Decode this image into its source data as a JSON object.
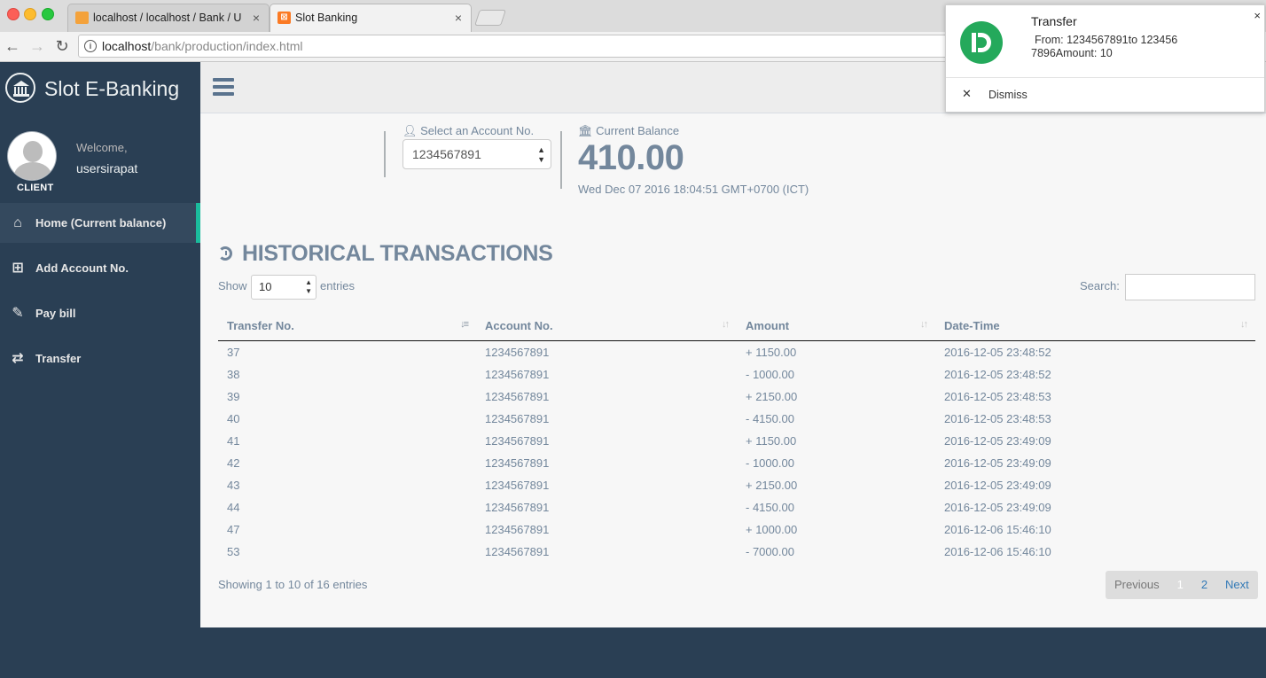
{
  "browser": {
    "tabs": [
      {
        "title": "localhost / localhost / Bank / U",
        "close": "×"
      },
      {
        "title": "Slot Banking",
        "close": "×"
      }
    ],
    "url_host": "localhost",
    "url_path": "/bank/production/index.html"
  },
  "sidebar": {
    "brand": "Slot E-Banking",
    "welcome": "Welcome,",
    "username": "usersirapat",
    "role": "CLIENT",
    "menu": [
      {
        "label": "Home (Current balance)",
        "icon": "home-icon"
      },
      {
        "label": "Add Account No.",
        "icon": "plus-square-icon"
      },
      {
        "label": "Pay bill",
        "icon": "edit-icon"
      },
      {
        "label": "Transfer",
        "icon": "exchange-icon"
      }
    ]
  },
  "account": {
    "select_label": "Select an Account No.",
    "selected": "1234567891"
  },
  "balance": {
    "label": "Current Balance",
    "value": "410.00",
    "datetime": "Wed Dec 07 2016 18:04:51 GMT+0700 (ICT)"
  },
  "history": {
    "title": "HISTORICAL TRANSACTIONS",
    "show_label": "Show",
    "page_size": "10",
    "entries_label": "entries",
    "search_label": "Search:",
    "search_value": "",
    "columns": [
      "Transfer No.",
      "Account No.",
      "Amount",
      "Date-Time"
    ],
    "rows": [
      [
        "37",
        "1234567891",
        "+ 1150.00",
        "2016-12-05 23:48:52"
      ],
      [
        "38",
        "1234567891",
        "- 1000.00",
        "2016-12-05 23:48:52"
      ],
      [
        "39",
        "1234567891",
        "+ 2150.00",
        "2016-12-05 23:48:53"
      ],
      [
        "40",
        "1234567891",
        "- 4150.00",
        "2016-12-05 23:48:53"
      ],
      [
        "41",
        "1234567891",
        "+ 1150.00",
        "2016-12-05 23:49:09"
      ],
      [
        "42",
        "1234567891",
        "- 1000.00",
        "2016-12-05 23:49:09"
      ],
      [
        "43",
        "1234567891",
        "+ 2150.00",
        "2016-12-05 23:49:09"
      ],
      [
        "44",
        "1234567891",
        "- 4150.00",
        "2016-12-05 23:49:09"
      ],
      [
        "47",
        "1234567891",
        "+ 1000.00",
        "2016-12-06 15:46:10"
      ],
      [
        "53",
        "1234567891",
        "- 7000.00",
        "2016-12-06 15:46:10"
      ]
    ],
    "info": "Showing 1 to 10 of 16 entries",
    "pagination": {
      "previous": "Previous",
      "pages": [
        "1",
        "2"
      ],
      "next": "Next"
    }
  },
  "notification": {
    "title": "Transfer",
    "body": "From: 1234567891to 1234567896Amount: 10",
    "dismiss": "Dismiss",
    "close": "×"
  },
  "colors": {
    "sidebar_bg": "#2a3f54",
    "active_accent": "#1abb9c",
    "text_muted": "#73879c",
    "notification_logo": "#24a95b"
  }
}
